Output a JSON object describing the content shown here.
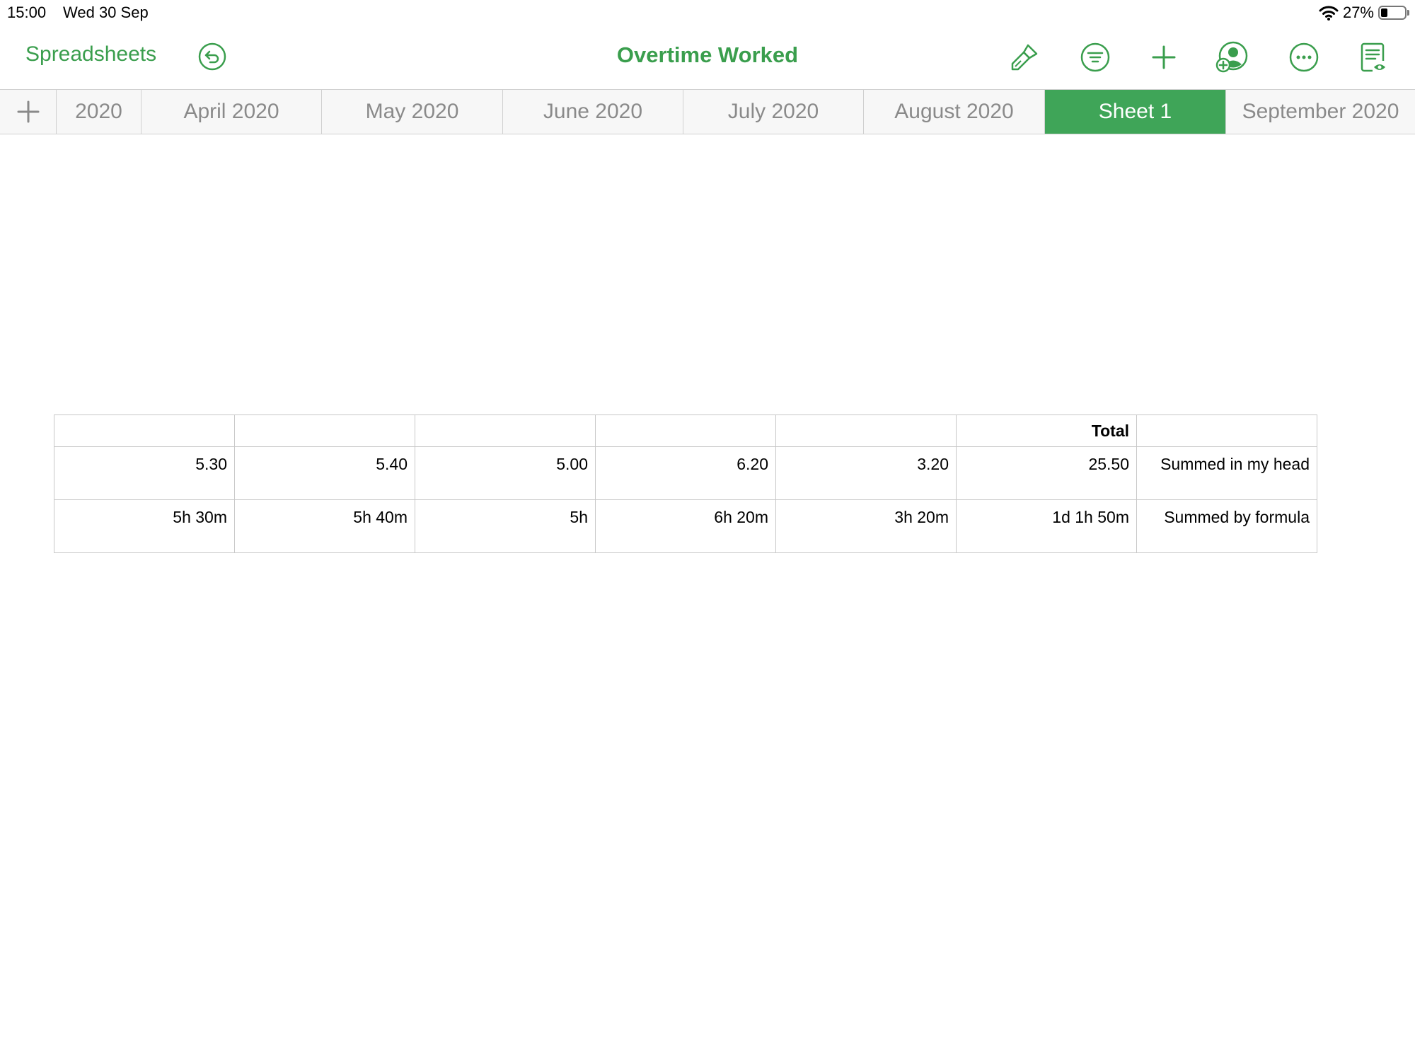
{
  "status": {
    "time": "15:00",
    "date": "Wed 30 Sep",
    "battery_percent": "27%",
    "battery_level": 0.27
  },
  "toolbar": {
    "back_label": "Spreadsheets",
    "title": "Overtime Worked",
    "accent_color": "#3a9e4d",
    "icons": [
      "undo-icon",
      "paintbrush-icon",
      "filter-icon",
      "plus-icon",
      "collaborate-icon",
      "more-icon",
      "reading-view-icon"
    ]
  },
  "tabs": [
    {
      "label": "2020",
      "active": false
    },
    {
      "label": "April 2020",
      "active": false
    },
    {
      "label": "May 2020",
      "active": false
    },
    {
      "label": "June 2020",
      "active": false
    },
    {
      "label": "July 2020",
      "active": false
    },
    {
      "label": "August 2020",
      "active": false
    },
    {
      "label": "Sheet 1",
      "active": true
    },
    {
      "label": "September 2020",
      "active": false
    }
  ],
  "table": {
    "header": [
      "",
      "",
      "",
      "",
      "",
      "Total",
      ""
    ],
    "rows": [
      [
        "5.30",
        "5.40",
        "5.00",
        "6.20",
        "3.20",
        "25.50",
        "Summed in my head"
      ],
      [
        "5h 30m",
        "5h 40m",
        "5h",
        "6h 20m",
        "3h 20m",
        "1d 1h 50m",
        "Summed by formula"
      ]
    ]
  }
}
